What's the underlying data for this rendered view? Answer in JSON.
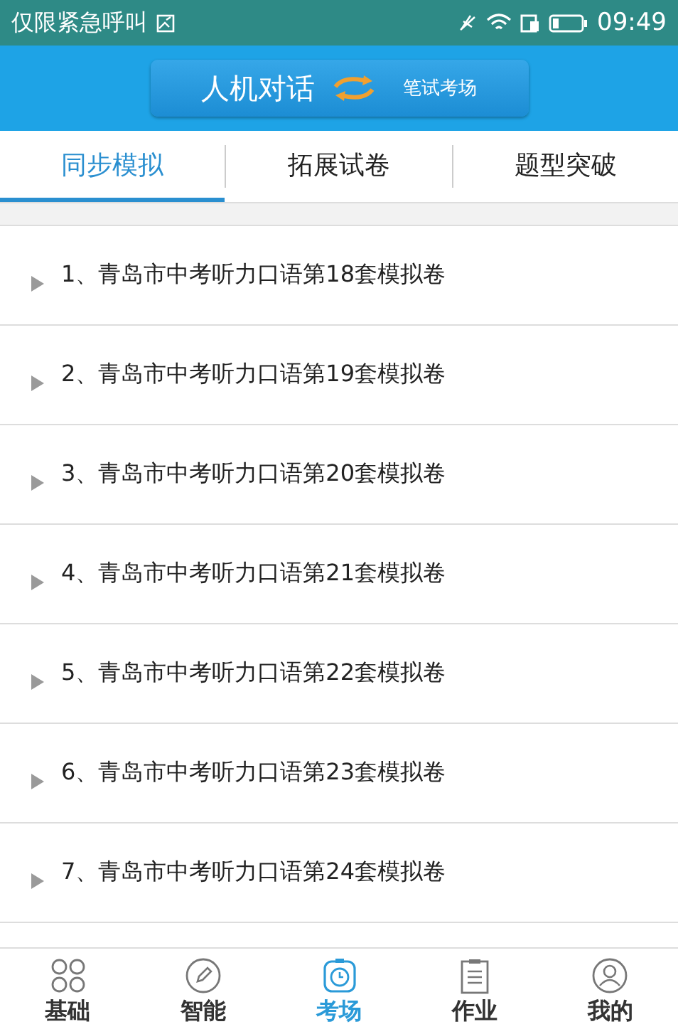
{
  "status_bar": {
    "carrier": "仅限紧急呼叫",
    "time": "09:49"
  },
  "header": {
    "toggle_left": "人机对话",
    "toggle_right": "笔试考场"
  },
  "tabs": [
    {
      "label": "同步模拟",
      "selected": true
    },
    {
      "label": "拓展试卷",
      "selected": false
    },
    {
      "label": "题型突破",
      "selected": false
    }
  ],
  "list": [
    {
      "title": "1、青岛市中考听力口语第18套模拟卷"
    },
    {
      "title": "2、青岛市中考听力口语第19套模拟卷"
    },
    {
      "title": "3、青岛市中考听力口语第20套模拟卷"
    },
    {
      "title": "4、青岛市中考听力口语第21套模拟卷"
    },
    {
      "title": "5、青岛市中考听力口语第22套模拟卷"
    },
    {
      "title": "6、青岛市中考听力口语第23套模拟卷"
    },
    {
      "title": "7、青岛市中考听力口语第24套模拟卷"
    }
  ],
  "bottom_nav": [
    {
      "label": "基础",
      "kind": "grid",
      "selected": false
    },
    {
      "label": "智能",
      "kind": "pencil",
      "selected": false
    },
    {
      "label": "考场",
      "kind": "clock",
      "selected": true
    },
    {
      "label": "作业",
      "kind": "clipboard",
      "selected": false
    },
    {
      "label": "我的",
      "kind": "person",
      "selected": false
    }
  ]
}
